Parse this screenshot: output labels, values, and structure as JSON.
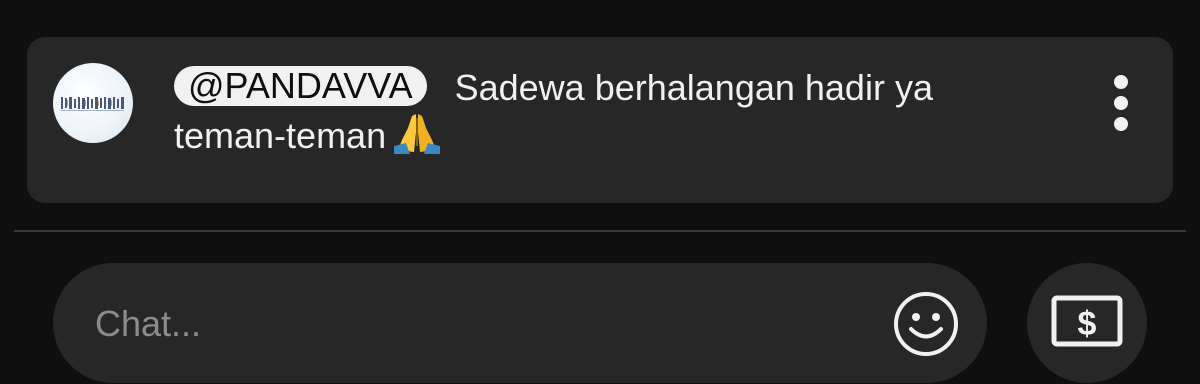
{
  "pinned_message": {
    "avatar_logo_text": "PANDAVVA",
    "author": "@PANDAVVA",
    "text_line1": "Sadewa berhalangan hadir ya",
    "text_line2": "teman-teman",
    "emoji": "folded-hands",
    "more_icon": "more-vert-icon"
  },
  "chat": {
    "placeholder": "Chat...",
    "value": "",
    "emoji_icon": "smiley-icon",
    "super_chat_icon": "dollar-bill-icon"
  },
  "colors": {
    "background": "#0f0f0f",
    "card": "#272727",
    "text": "#f1f1f1",
    "placeholder": "#8c8c8c",
    "divider": "#3a3a3a"
  }
}
